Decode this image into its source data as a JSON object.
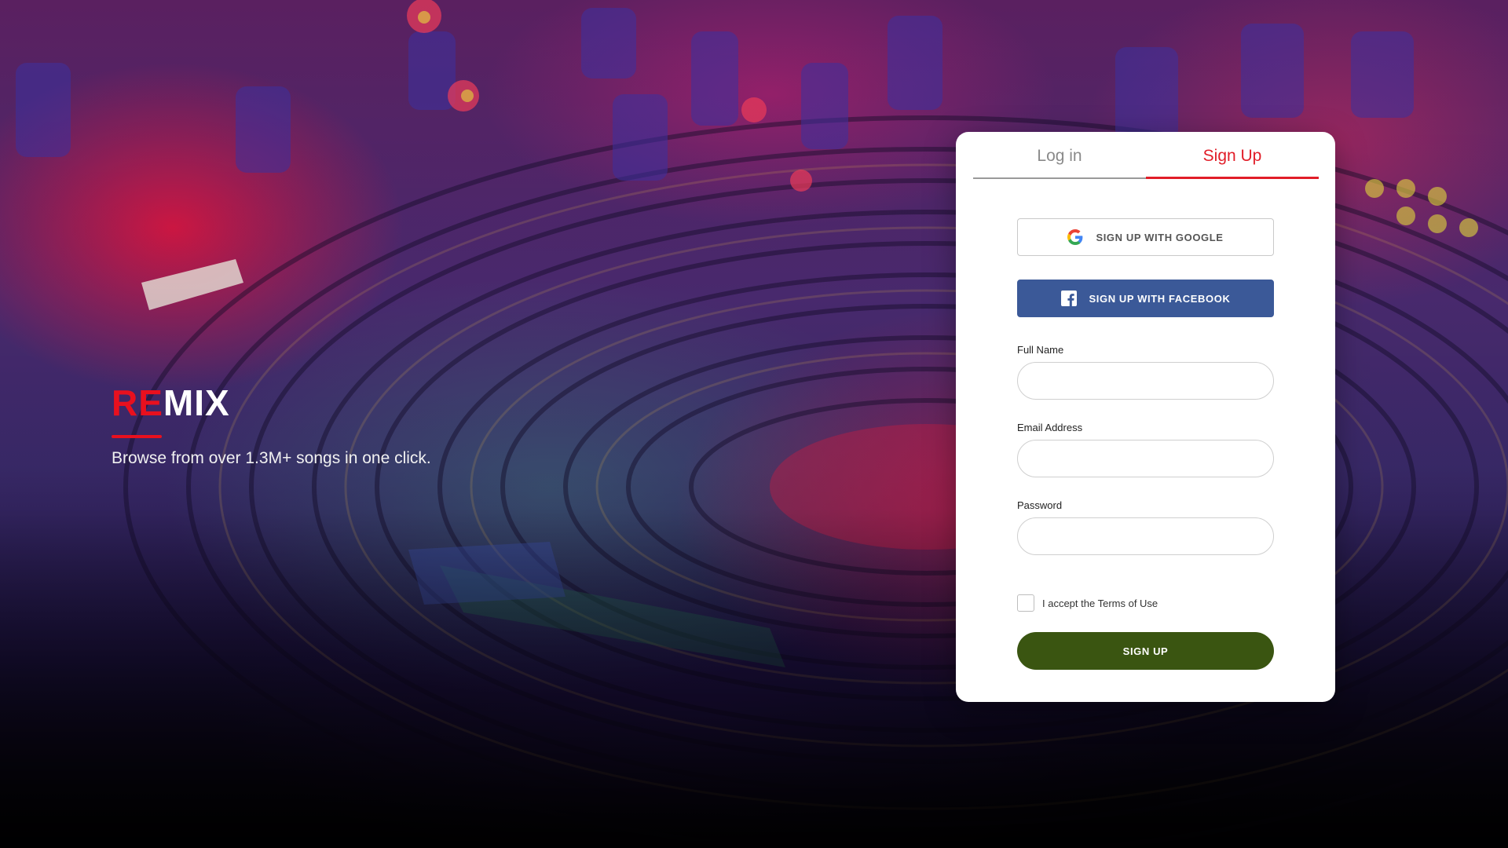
{
  "brand": {
    "logo_part1": "RE",
    "logo_part2": "MIX",
    "tagline": "Browse from over 1.3M+ songs in one click."
  },
  "tabs": [
    {
      "label": "Log in",
      "active": false
    },
    {
      "label": "Sign Up",
      "active": true
    }
  ],
  "social": {
    "google_label": "SIGN UP WITH GOOGLE",
    "facebook_label": "SIGN UP WITH FACEBOOK"
  },
  "fields": {
    "full_name": {
      "label": "Full Name",
      "value": "",
      "placeholder": ""
    },
    "email": {
      "label": "Email Address",
      "value": "",
      "placeholder": ""
    },
    "password": {
      "label": "Password",
      "value": "",
      "placeholder": ""
    }
  },
  "terms": {
    "label": "I accept the Terms of Use",
    "checked": false
  },
  "submit_label": "SIGN UP",
  "colors": {
    "accent_red": "#e11d28",
    "facebook_blue": "#3b5998",
    "submit_green": "#3a5511"
  },
  "icons": {
    "google": "google-icon",
    "facebook": "facebook-icon"
  }
}
